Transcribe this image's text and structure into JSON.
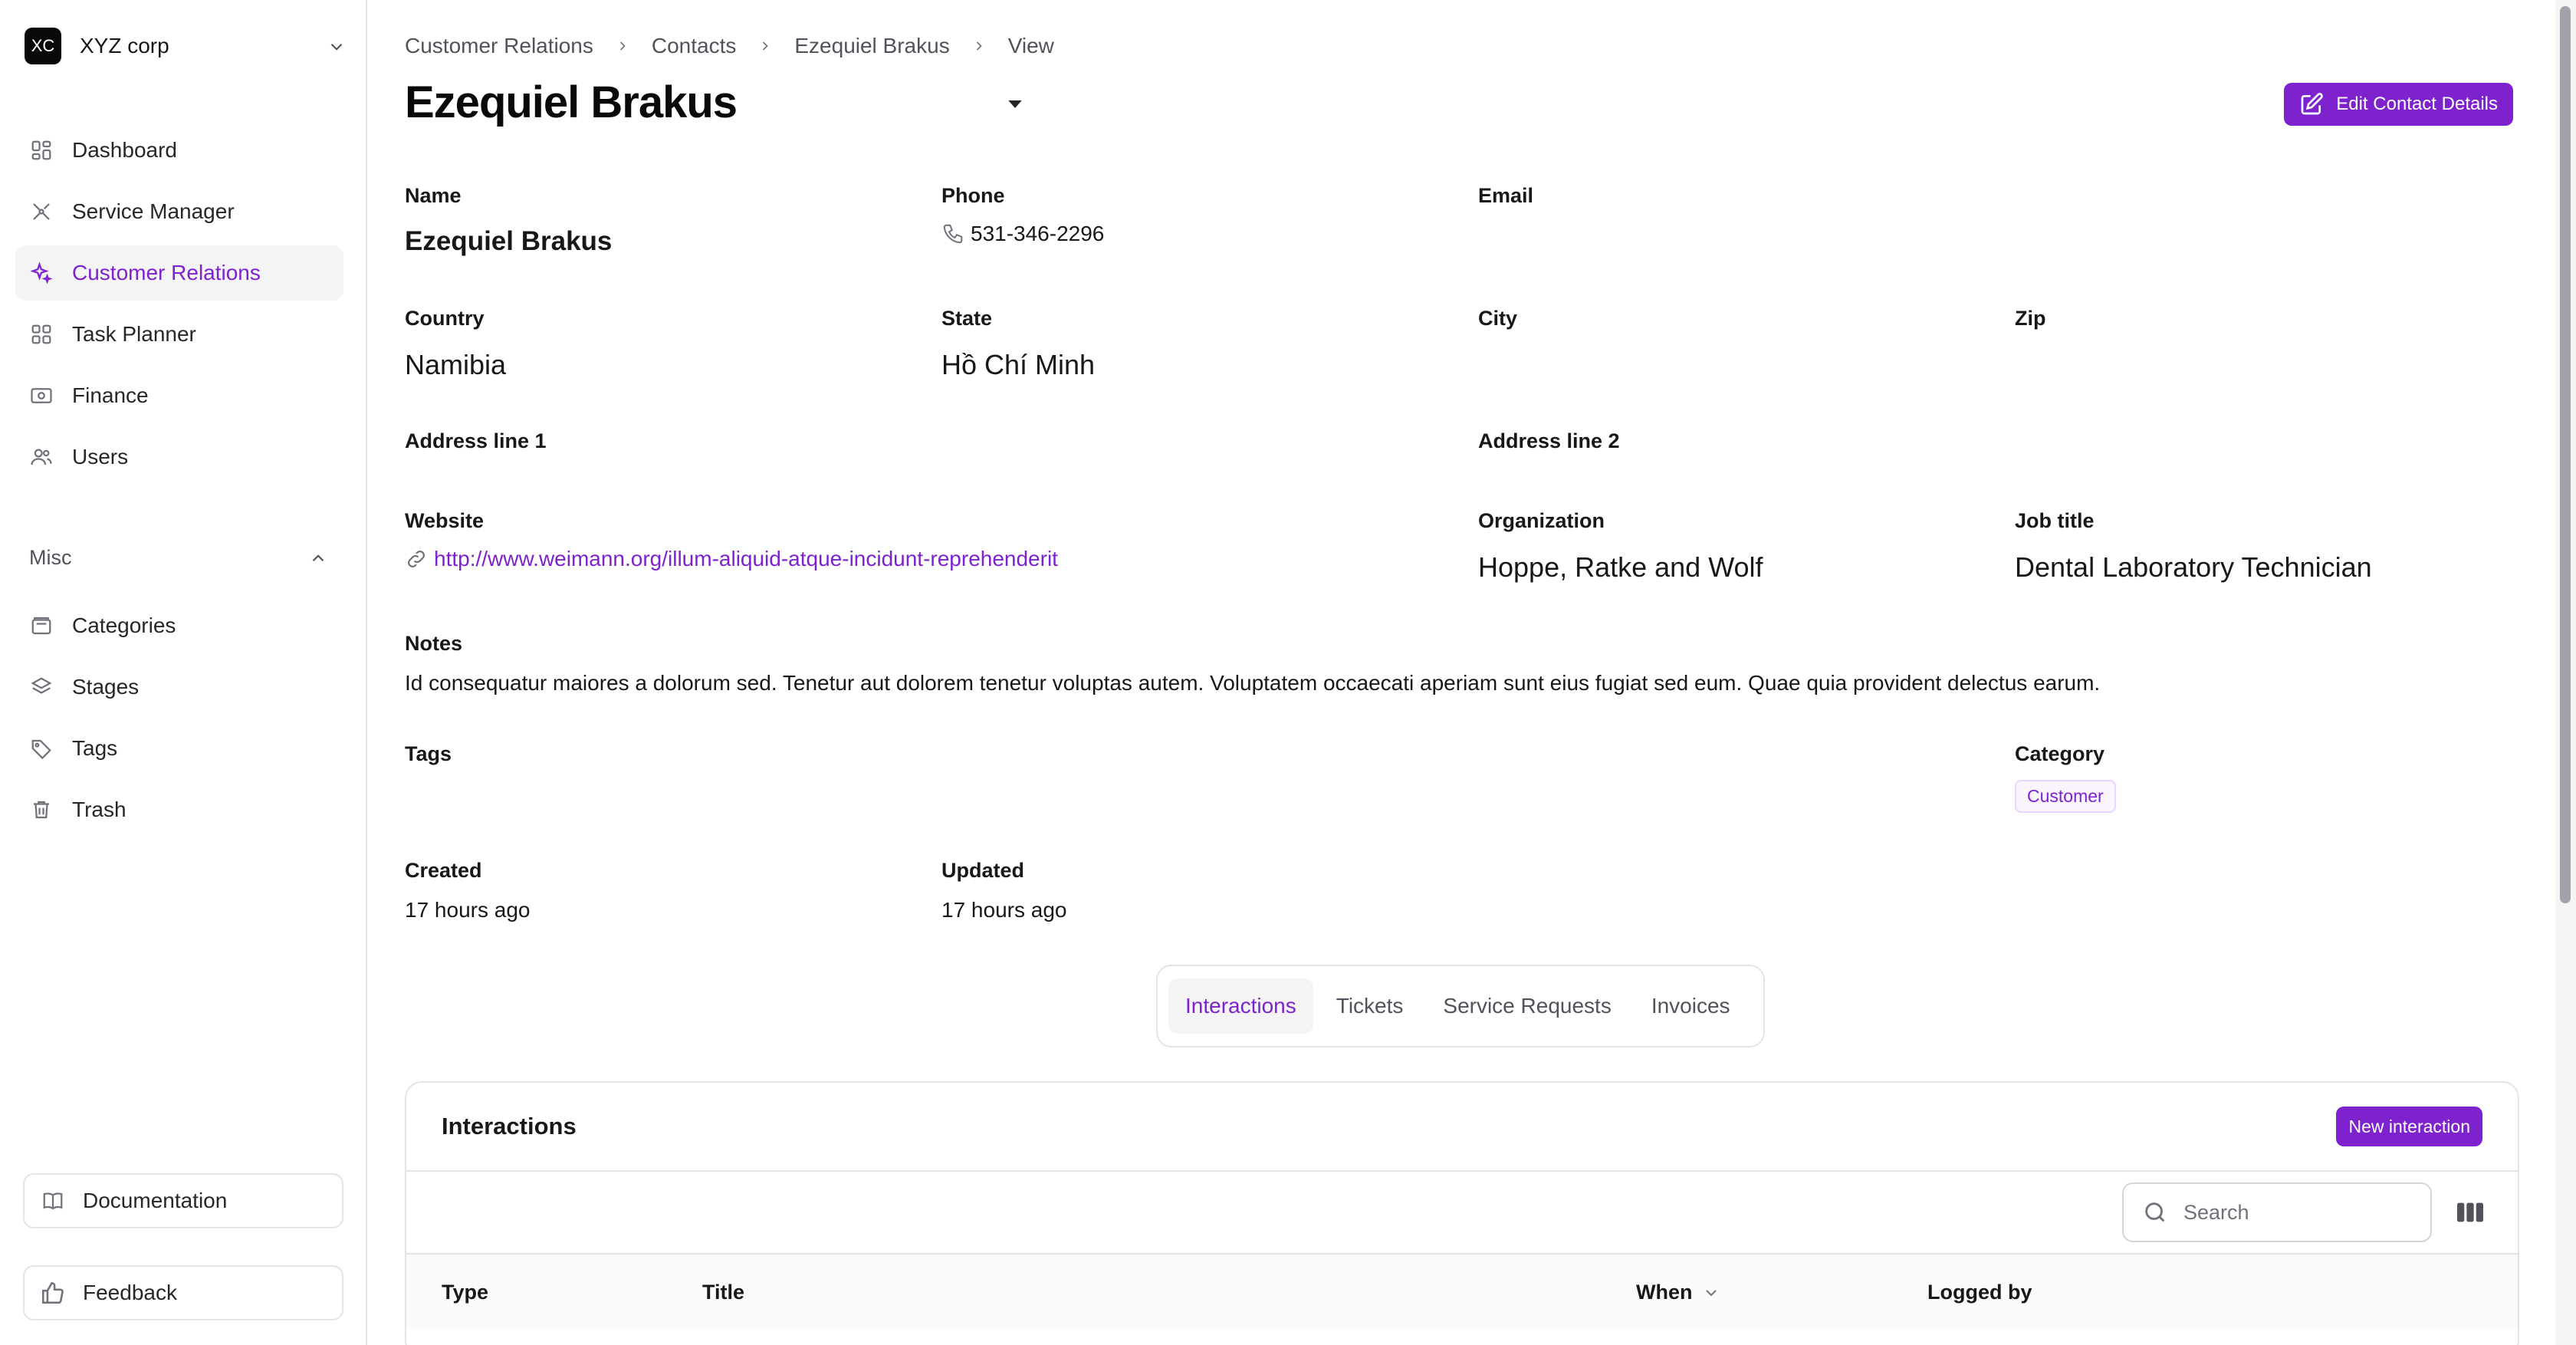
{
  "brand": {
    "logo_text": "XC",
    "name": "XYZ corp"
  },
  "nav": {
    "items": [
      {
        "label": "Dashboard",
        "icon": "grid-icon"
      },
      {
        "label": "Service Manager",
        "icon": "tools-icon"
      },
      {
        "label": "Customer Relations",
        "icon": "sparkles-icon",
        "active": true
      },
      {
        "label": "Task Planner",
        "icon": "grid-icon"
      },
      {
        "label": "Finance",
        "icon": "banknote-icon"
      },
      {
        "label": "Users",
        "icon": "users-icon"
      }
    ],
    "misc_label": "Misc",
    "misc_items": [
      {
        "label": "Categories",
        "icon": "folder-icon"
      },
      {
        "label": "Stages",
        "icon": "layers-icon"
      },
      {
        "label": "Tags",
        "icon": "tag-icon"
      },
      {
        "label": "Trash",
        "icon": "trash-icon"
      }
    ],
    "documentation_label": "Documentation",
    "feedback_label": "Feedback"
  },
  "breadcrumb": [
    "Customer Relations",
    "Contacts",
    "Ezequiel Brakus",
    "View"
  ],
  "page": {
    "title": "Ezequiel Brakus",
    "edit_button": "Edit Contact Details"
  },
  "contact": {
    "name_label": "Name",
    "name": "Ezequiel Brakus",
    "phone_label": "Phone",
    "phone": "531-346-2296",
    "email_label": "Email",
    "country_label": "Country",
    "country": "Namibia",
    "state_label": "State",
    "state": "Hồ Chí Minh",
    "city_label": "City",
    "zip_label": "Zip",
    "address1_label": "Address line 1",
    "address2_label": "Address line 2",
    "website_label": "Website",
    "website": "http://www.weimann.org/illum-aliquid-atque-incidunt-reprehenderit",
    "organization_label": "Organization",
    "organization": "Hoppe, Ratke and Wolf",
    "job_title_label": "Job title",
    "job_title": "Dental Laboratory Technician",
    "notes_label": "Notes",
    "notes": "Id consequatur maiores a dolorum sed. Tenetur aut dolorem tenetur voluptas autem. Voluptatem occaecati aperiam sunt eius fugiat sed eum. Quae quia provident delectus earum.",
    "tags_label": "Tags",
    "category_label": "Category",
    "category": "Customer",
    "created_label": "Created",
    "created": "17 hours ago",
    "updated_label": "Updated",
    "updated": "17 hours ago"
  },
  "tabs": [
    "Interactions",
    "Tickets",
    "Service Requests",
    "Invoices"
  ],
  "interactions": {
    "title": "Interactions",
    "new_button": "New interaction",
    "search_placeholder": "Search",
    "columns": [
      "Type",
      "Title",
      "When",
      "Logged by"
    ]
  },
  "colors": {
    "accent": "#7e22ce",
    "border": "#e4e4e7"
  }
}
